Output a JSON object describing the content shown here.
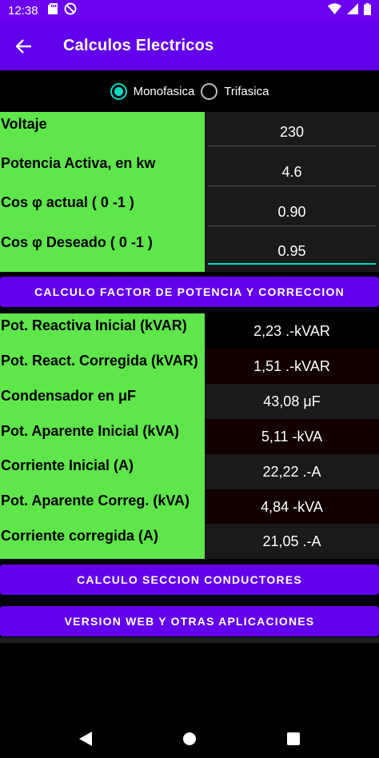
{
  "status_bar": {
    "time": "12:38"
  },
  "app_bar": {
    "title": "Calculos Electricos"
  },
  "phase": {
    "options": [
      {
        "label": "Monofasica",
        "checked": true
      },
      {
        "label": "Trifasica",
        "checked": false
      }
    ]
  },
  "inputs": [
    {
      "label": "Voltaje",
      "value": "230"
    },
    {
      "label": "Potencia Activa, en kw",
      "value": "4.6"
    },
    {
      "label": "Cos φ actual ( 0 -1 )",
      "value": "0.90"
    },
    {
      "label": "Cos φ Deseado ( 0 -1 )",
      "value": "0.95"
    }
  ],
  "buttons": {
    "power_factor": "CALCULO FACTOR DE POTENCIA Y CORRECCION",
    "conductor_section": "CALCULO SECCION CONDUCTORES",
    "web_version": "VERSION WEB Y OTRAS APLICACIONES"
  },
  "results": [
    {
      "label": "Pot. Reactiva Inicial (kVAR)",
      "value": "2,23 .-kVAR"
    },
    {
      "label": "Pot. React. Corregida (kVAR)",
      "value": "1,51 .-kVAR"
    },
    {
      "label": "Condensador en μF",
      "value": "43,08 μF"
    },
    {
      "label": "Pot. Aparente Inicial (kVA)",
      "value": "5,11 -kVA"
    },
    {
      "label": "Corriente Inicial (A)",
      "value": "22,22 .-A"
    },
    {
      "label": "Pot. Aparente Correg. (kVA)",
      "value": "4,84 -kVA"
    },
    {
      "label": "Corriente corregida (A)",
      "value": "21,05 .-A"
    }
  ],
  "colors": {
    "primary": "#6200ee",
    "accent": "#03dac5",
    "label_bg": "#5fe64b"
  }
}
